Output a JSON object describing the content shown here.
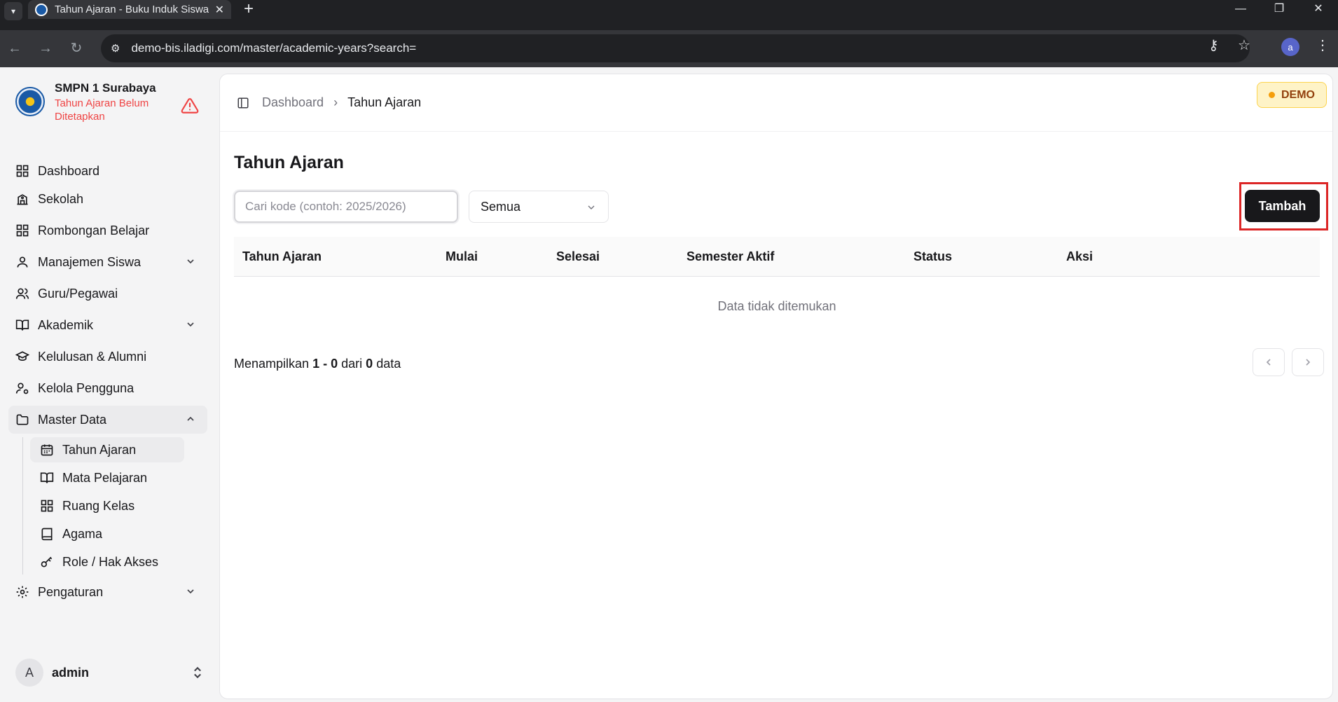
{
  "browser": {
    "tab_title": "Tahun Ajaran - Buku Induk Siswa",
    "url": "demo-bis.iladigi.com/master/academic-years?search="
  },
  "sidebar": {
    "school_name": "SMPN 1 Surabaya",
    "school_status": "Tahun Ajaran Belum Ditetapkan",
    "items": [
      {
        "label": "Dashboard",
        "icon": "grid-icon"
      },
      {
        "label": "Sekolah",
        "icon": "school-icon"
      },
      {
        "label": "Rombongan Belajar",
        "icon": "grid-icon"
      },
      {
        "label": "Manajemen Siswa",
        "icon": "user-icon"
      },
      {
        "label": "Guru/Pegawai",
        "icon": "users-icon"
      },
      {
        "label": "Akademik",
        "icon": "book-open-icon"
      },
      {
        "label": "Kelulusan & Alumni",
        "icon": "graduation-cap-icon"
      },
      {
        "label": "Kelola Pengguna",
        "icon": "user-cog-icon"
      },
      {
        "label": "Master Data",
        "icon": "folder-icon"
      },
      {
        "label": "Pengaturan",
        "icon": "gear-icon"
      }
    ],
    "master_sub": [
      {
        "label": "Tahun Ajaran",
        "icon": "calendar-icon"
      },
      {
        "label": "Mata Pelajaran",
        "icon": "book-open-icon"
      },
      {
        "label": "Ruang Kelas",
        "icon": "grid-icon"
      },
      {
        "label": "Agama",
        "icon": "book-icon"
      },
      {
        "label": "Role / Hak Akses",
        "icon": "key-icon"
      }
    ],
    "user": {
      "initial": "A",
      "name": "admin"
    }
  },
  "header": {
    "breadcrumb": [
      "Dashboard",
      "Tahun Ajaran"
    ],
    "badge": "DEMO"
  },
  "main": {
    "title": "Tahun Ajaran",
    "search_placeholder": "Cari kode (contoh: 2025/2026)",
    "search_value": "",
    "filter_value": "Semua",
    "add_label": "Tambah",
    "table": {
      "columns": [
        "Tahun Ajaran",
        "Mulai",
        "Selesai",
        "Semester Aktif",
        "Status",
        "Aksi"
      ],
      "empty": "Data tidak ditemukan"
    },
    "footer": {
      "prefix": "Menampilkan",
      "range": "1 - 0",
      "mid": "dari",
      "total": "0",
      "suffix": "data"
    }
  },
  "colors": {
    "accent": "#18181b",
    "highlight": "#dc2626",
    "warning": "#ef4444",
    "demo_bg": "#fef3c7"
  }
}
